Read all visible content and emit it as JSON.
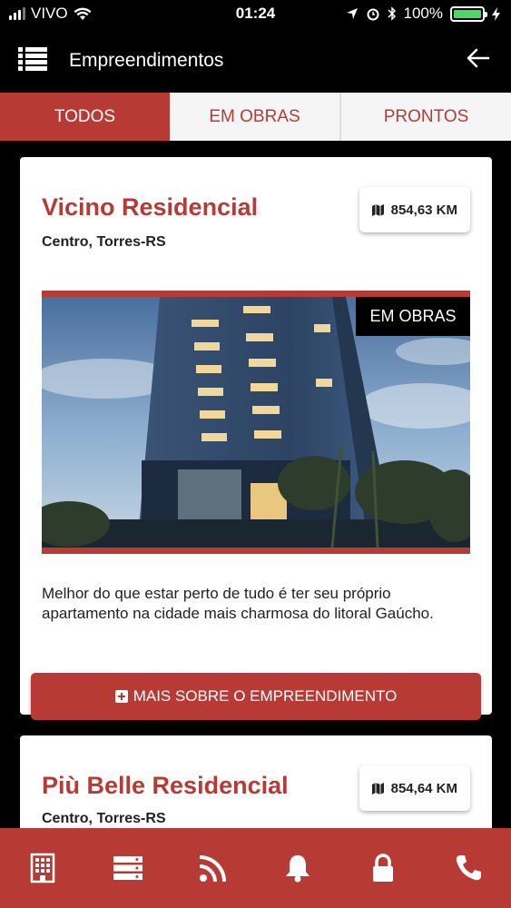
{
  "status_bar": {
    "carrier": "VIVO",
    "time": "01:24",
    "battery": "100%"
  },
  "appbar": {
    "title": "Empreendimentos",
    "menu_icon": "list-icon",
    "back_icon": "arrow-left-icon"
  },
  "tabs": [
    {
      "label": "TODOS",
      "active": true
    },
    {
      "label": "EM OBRAS",
      "active": false
    },
    {
      "label": "PRONTOS",
      "active": false
    }
  ],
  "listings": [
    {
      "title": "Vicino Residencial",
      "location": "Centro, Torres-RS",
      "distance": "854,63 KM",
      "status": "EM OBRAS",
      "description": "Melhor do que estar perto de tudo é ter seu próprio apartamento na cidade mais charmosa do litoral Gaúcho.",
      "button_label": "MAIS SOBRE O EMPREENDIMENTO"
    },
    {
      "title": "Più Belle Residencial",
      "location": "Centro, Torres-RS",
      "distance": "854,64 KM"
    }
  ],
  "bottom_nav": [
    {
      "icon": "building-icon"
    },
    {
      "icon": "server-icon"
    },
    {
      "icon": "rss-icon"
    },
    {
      "icon": "bell-icon"
    },
    {
      "icon": "lock-icon"
    },
    {
      "icon": "phone-icon"
    }
  ],
  "colors": {
    "accent": "#b83a35",
    "background": "#000000",
    "card": "#ffffff"
  }
}
